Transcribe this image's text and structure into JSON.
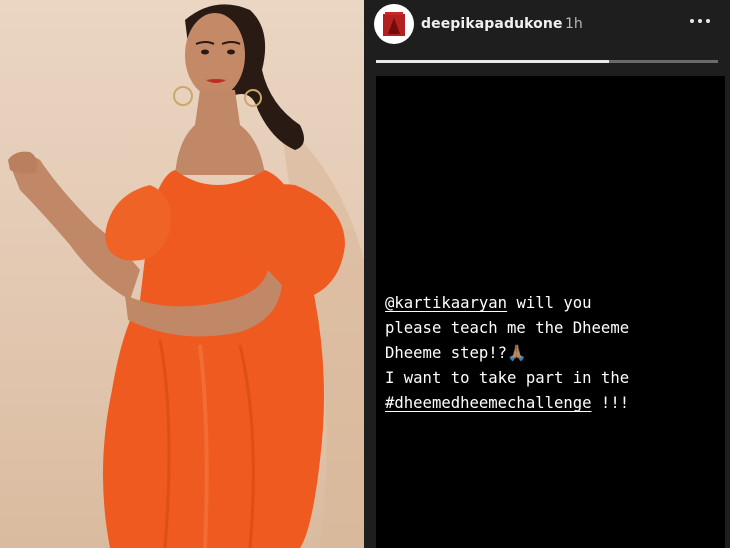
{
  "story": {
    "username": "deepikapadukone",
    "time_ago": "1h",
    "progress": 0.68,
    "avatar_icon": "profile-avatar",
    "more_icon": "more-options-icon"
  },
  "caption": {
    "mention": "@kartikaaryan",
    "line1_rest": " will you\nplease teach me the Dheeme\nDheeme step!?🙏🏽\nI want to take part in the\n",
    "hashtag": "#dheemedheemechallenge",
    "tail": " !!!"
  },
  "colors": {
    "dress": "#ef5a21",
    "photo_background": "#e6cfb9",
    "story_card": "#000000",
    "panel": "#1e1e1e"
  }
}
